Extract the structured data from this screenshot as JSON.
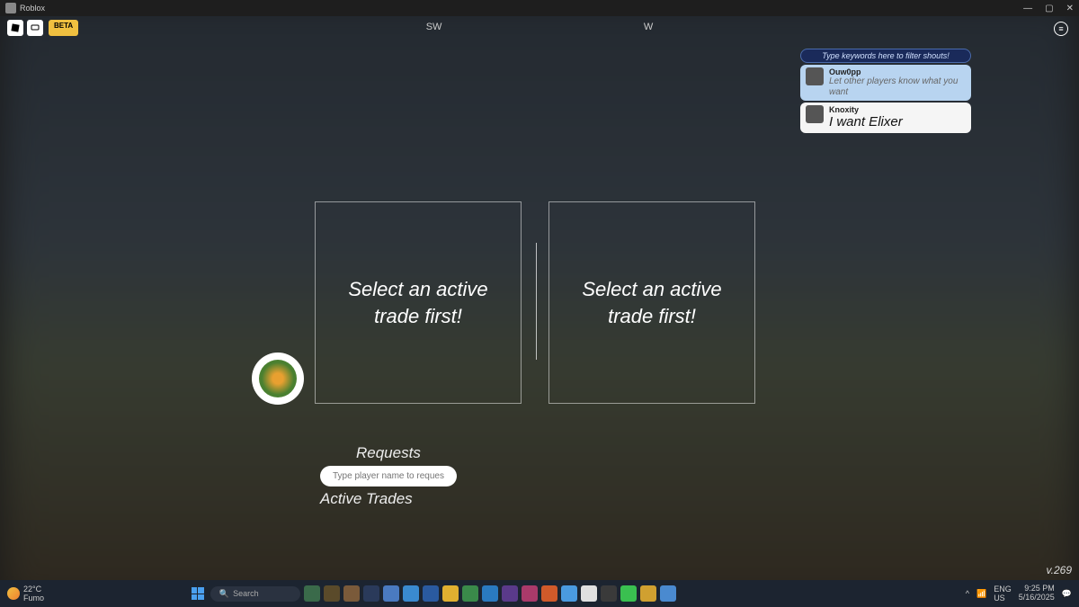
{
  "titlebar": {
    "app_name": "Roblox"
  },
  "roblox": {
    "beta_label": "BETA"
  },
  "compass": {
    "sw": "SW",
    "w": "W"
  },
  "shouts": {
    "filter_placeholder": "Type keywords here to filter shouts!",
    "items": [
      {
        "name": "Ouw0pp",
        "message": "Let other players know what you want"
      },
      {
        "name": "Knoxity",
        "message": "I want Elixer"
      }
    ]
  },
  "trade": {
    "left_msg": "Select an active trade first!",
    "right_msg": "Select an active trade first!",
    "requests_label": "Requests",
    "player_input_placeholder": "Type player name to request",
    "active_trades_label": "Active Trades"
  },
  "version": "v.269",
  "taskbar": {
    "weather_temp": "22°C",
    "weather_desc": "Fumo",
    "search_placeholder": "Search",
    "lang1": "ENG",
    "lang2": "US",
    "time": "9:25 PM",
    "date": "5/16/2025"
  }
}
